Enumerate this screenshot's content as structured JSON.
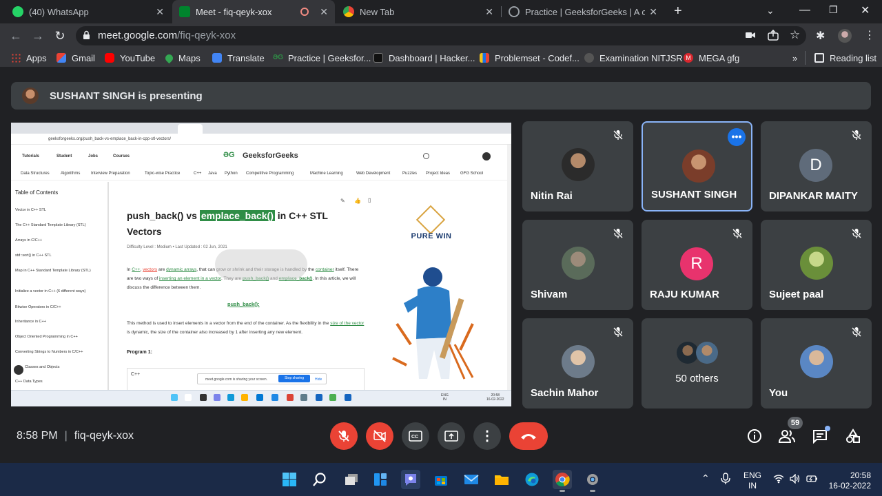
{
  "browser": {
    "tabs": [
      {
        "title": "(40) WhatsApp",
        "favicon": "whatsapp-icon",
        "color": "#25d366",
        "active": false
      },
      {
        "title": "Meet - fiq-qeyk-xox",
        "favicon": "meet-icon",
        "color": "#00832d",
        "active": true
      },
      {
        "title": "New Tab",
        "favicon": "chrome-icon",
        "color": "#9aa0a6",
        "active": false
      },
      {
        "title": "Practice | GeeksforGeeks | A com",
        "favicon": "globe-icon",
        "color": "#9aa0a6",
        "active": false
      }
    ],
    "url_host": "meet.google.com",
    "url_path": "/fiq-qeyk-xox",
    "bookmarks": [
      {
        "label": "Apps",
        "icon": "apps-grid-icon"
      },
      {
        "label": "Gmail",
        "icon": "gmail-icon"
      },
      {
        "label": "YouTube",
        "icon": "youtube-icon"
      },
      {
        "label": "Maps",
        "icon": "maps-icon"
      },
      {
        "label": "Translate",
        "icon": "translate-icon"
      },
      {
        "label": "Practice | Geeksfor...",
        "icon": "gfg-icon"
      },
      {
        "label": "Dashboard | Hacker...",
        "icon": "hackerrank-icon"
      },
      {
        "label": "Problemset - Codef...",
        "icon": "codeforces-icon"
      },
      {
        "label": "Examination NITJSR",
        "icon": "nitjsr-icon"
      },
      {
        "label": "MEGA gfg",
        "icon": "mega-icon"
      }
    ],
    "reading_list": "Reading list",
    "more_bookmarks": "»"
  },
  "meet": {
    "presenting_banner": "SUSHANT SINGH is presenting",
    "time": "8:58 PM",
    "meeting_code": "fiq-qeyk-xox",
    "participant_badge": "59",
    "participants": [
      {
        "name": "Nitin Rai",
        "type": "photo"
      },
      {
        "name": "SUSHANT SINGH",
        "type": "photo",
        "selected": true
      },
      {
        "name": "DIPANKAR MAITY",
        "type": "letter",
        "letter": "D",
        "color": "#5f6b7a"
      },
      {
        "name": "Shivam",
        "type": "photo"
      },
      {
        "name": "RAJU KUMAR",
        "type": "letter",
        "letter": "R",
        "color": "#e8336d"
      },
      {
        "name": "Sujeet paal",
        "type": "photo"
      },
      {
        "name": "Sachin Mahor",
        "type": "photo"
      },
      {
        "name": "50 others",
        "type": "group"
      },
      {
        "name": "You",
        "type": "photo"
      }
    ]
  },
  "shared_screen": {
    "url": "geeksforgeeks.org/push_back-vs-emplace_back-in-cpp-stl-vectors/",
    "site_name": "GeeksforGeeks",
    "menu": [
      "Tutorials",
      "Student",
      "Jobs",
      "Courses"
    ],
    "categories": [
      "Data Structures",
      "Algorithms",
      "Interview Preparation",
      "Topic-wise Practice",
      "C++",
      "Java",
      "Python",
      "Competitive Programming",
      "Machine Learning",
      "Web Development",
      "Puzzles",
      "Project Ideas",
      "GFG School"
    ],
    "toc_title": "Table of Contents",
    "toc": [
      "Vector in C++ STL",
      "The C++ Standard Template Library (STL)",
      "Arrays in C/C++",
      "std::sort() in C++ STL",
      "Map in C++ Standard Template Library (STL)",
      "Initialize a vector in C++ (6 different ways)",
      "Bitwise Operators in C/C++",
      "Inheritance in C++",
      "Object Oriented Programming in C++",
      "Converting Strings to Numbers in C/C++",
      "Classes and Objects",
      "C++ Data Types"
    ],
    "title_pre": "push_back() vs ",
    "title_hl": "emplace_back()",
    "title_post": " in C++ STL Vectors",
    "meta": "Difficulty Level : Medium  •  Last Updated : 02 Jun, 2021",
    "para1_a": "In ",
    "para1_b": "C++",
    "para1_c": ", ",
    "para1_d": "vectors",
    "para1_e": " are ",
    "para1_f": "dynamic arrays",
    "para1_g": ", that can grow or shrink and their storage is handled by the ",
    "para1_h": "container",
    "para1_i": " itself. There are two ways of ",
    "para1_j": "inserting an element in a vector",
    "para1_k": ". They are ",
    "para1_l": "push_back()",
    "para1_m": " and ",
    "para1_n": "emplace_back()",
    "para1_o": ". In this article, we will discuss the difference between them.",
    "push_heading": "push_back():",
    "para2_a": "This method is used to insert elements in a vector from the end of the container. As the flexibility in the ",
    "para2_b": "size of the vector",
    "para2_c": " is dynamic, the size of the container also increased by 1 after inserting any new element.",
    "program": "Program 1:",
    "code_lang": "C++",
    "share_text": "meet.google.com is sharing your screen.",
    "stop_sharing": "Stop sharing",
    "hide": "Hide",
    "ad_brand": "PURE WIN"
  },
  "taskbar": {
    "lang_top": "ENG",
    "lang_bottom": "IN",
    "time": "20:58",
    "date": "16-02-2022"
  }
}
